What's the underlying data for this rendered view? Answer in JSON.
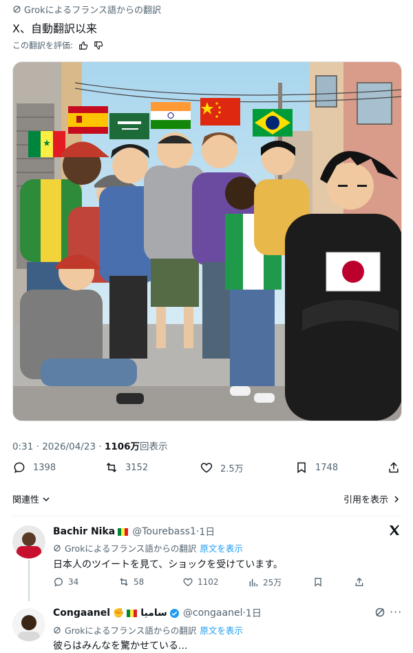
{
  "post": {
    "translation_label": "Grokによるフランス語からの翻訳",
    "text": "X、自動翻訳以来",
    "rate_label": "この翻訳を評価:",
    "meta": {
      "time": "0:31",
      "date": "2026/04/23",
      "views_count": "1106",
      "views_unit": "万",
      "views_label": "回表示"
    },
    "actions": {
      "replies": "1398",
      "reposts": "3152",
      "likes": "2.5万",
      "bookmarks": "1748"
    },
    "sort_label": "関連性",
    "quotes_label": "引用を表示"
  },
  "replies": [
    {
      "name": "Bachir Nika",
      "handle": "@Tourebass1",
      "time": "1日",
      "translation_label": "Grokによるフランス語からの翻訳",
      "show_original": "原文を表示",
      "text": "日本人のツイートを見て、ショックを受けています。",
      "actions": {
        "replies": "34",
        "reposts": "58",
        "likes": "1102",
        "views": "25万"
      }
    },
    {
      "name": "Congaanel",
      "name_arabic": "ساميا",
      "handle": "@congaanel",
      "time": "1日",
      "translation_label": "Grokによるフランス語からの翻訳",
      "show_original": "原文を表示",
      "text": "彼らはみんなを驚かせている..."
    }
  ],
  "colors": {
    "accent": "#1d9bf0",
    "secondary_text": "#536471",
    "primary_text": "#0f1419"
  },
  "icons": [
    "grok-icon",
    "thumbs-up-icon",
    "thumbs-down-icon",
    "reply-icon",
    "repost-icon",
    "like-icon",
    "bookmark-icon",
    "share-icon",
    "chevron-down-icon",
    "chevron-right-icon",
    "x-logo-icon",
    "views-icon",
    "verified-icon",
    "more-icon"
  ]
}
